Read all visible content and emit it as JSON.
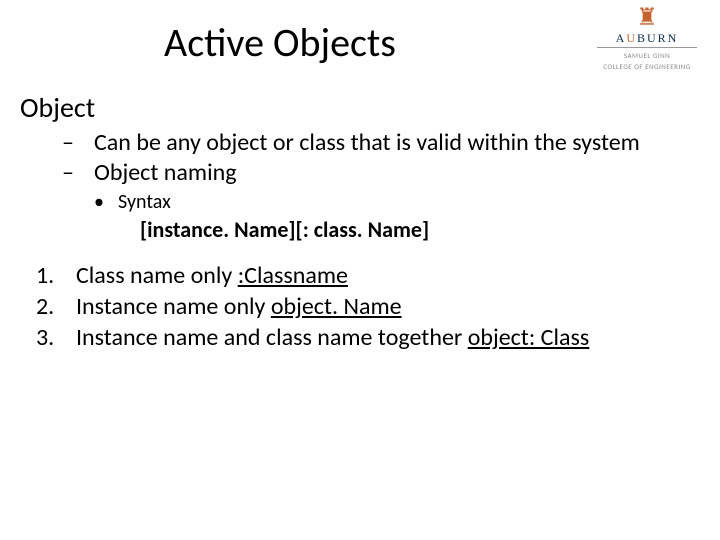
{
  "title": "Active Objects",
  "logo": {
    "wordmark": "AUBURN",
    "subline1": "SAMUEL GINN",
    "subline2": "COLLEGE OF ENGINEERING"
  },
  "section_heading": "Object",
  "dash_items": [
    "Can be any object or class that is valid within the system",
    "Object naming"
  ],
  "dot_label": "Syntax",
  "syntax_pattern": "[instance. Name][: class. Name]",
  "numbered": [
    {
      "n": "1.",
      "prefix": "Class name only   ",
      "u": ":Classname",
      "suffix": ""
    },
    {
      "n": "2.",
      "prefix": "Instance name only  ",
      "u": "object. Name",
      "suffix": ""
    },
    {
      "n": "3.",
      "prefix": "Instance name and class name together ",
      "u": "object: Class",
      "suffix": ""
    }
  ]
}
